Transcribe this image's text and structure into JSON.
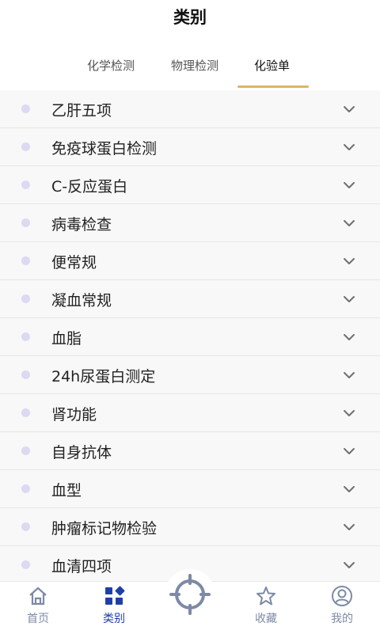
{
  "header": {
    "title": "类别"
  },
  "tabs": [
    {
      "label": "化学检测",
      "active": false
    },
    {
      "label": "物理检测",
      "active": false
    },
    {
      "label": "化验单",
      "active": true
    }
  ],
  "items": [
    {
      "label": "乙肝五项"
    },
    {
      "label": "免疫球蛋白检测"
    },
    {
      "label": "C-反应蛋白"
    },
    {
      "label": "病毒检查"
    },
    {
      "label": "便常规"
    },
    {
      "label": "凝血常规"
    },
    {
      "label": "血脂"
    },
    {
      "label": "24h尿蛋白测定"
    },
    {
      "label": "肾功能"
    },
    {
      "label": "自身抗体"
    },
    {
      "label": "血型"
    },
    {
      "label": "肿瘤标记物检验"
    },
    {
      "label": "血清四项"
    }
  ],
  "tabbar": {
    "home": "首页",
    "category": "类别",
    "favorites": "收藏",
    "mine": "我的"
  },
  "colors": {
    "accent_underline": "#e0b46a",
    "active_tab": "#1f3fa8",
    "inactive_tab": "#7d8aa6",
    "bullet": "#dcdaf2"
  }
}
